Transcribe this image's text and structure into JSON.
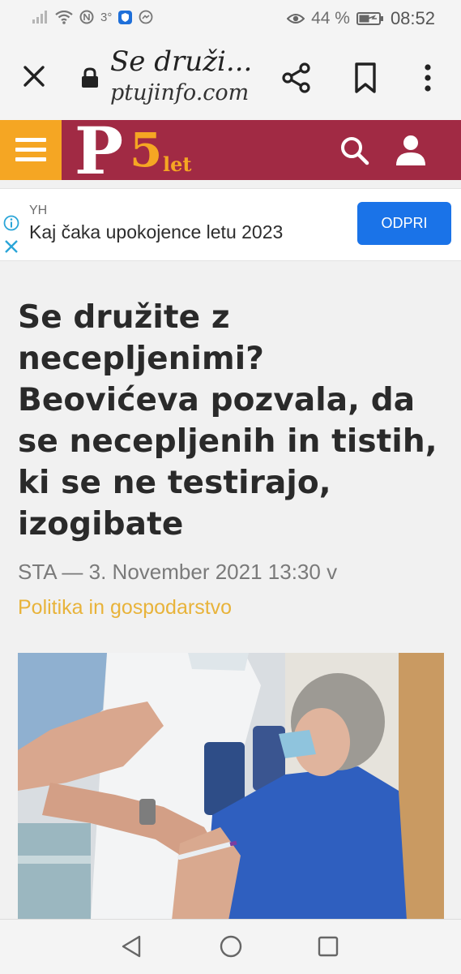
{
  "status_bar": {
    "temperature": "3°",
    "battery_percent": "44 %",
    "time": "08:52",
    "icons": [
      "signal-icon",
      "wifi-icon",
      "nfc-icon",
      "shield-app-icon",
      "messenger-icon",
      "eye-comfort-icon",
      "battery-icon"
    ]
  },
  "browser": {
    "page_title": "Se druži...",
    "domain": "ptujinfo.com"
  },
  "site_header": {
    "logo_letter": "P",
    "logo_number": "5",
    "logo_suffix": "let",
    "colors": {
      "bar": "#a12a44",
      "accent": "#f5a623"
    }
  },
  "ad": {
    "sponsor": "YH",
    "headline": "Kaj čaka upokojence letu 2023",
    "cta": "ODPRI"
  },
  "article": {
    "title": "Se družite z necepljenimi? Beovićeva pozvala, da se necepljenih in tistih, ki se ne testirajo, izogibate",
    "meta": "STA — 3. November 2021 13:30 v",
    "category": "Politika in gospodarstvo"
  }
}
